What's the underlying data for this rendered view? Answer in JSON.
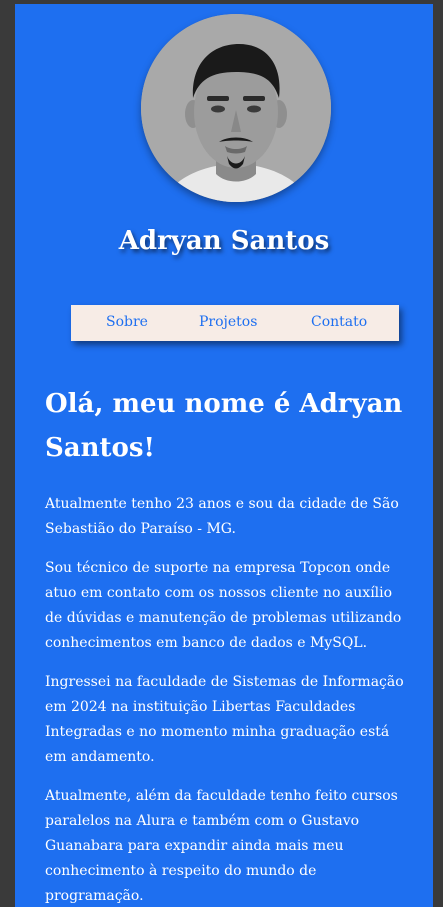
{
  "profile": {
    "name": "Adryan Santos"
  },
  "nav": {
    "items": [
      "Sobre",
      "Projetos",
      "Contato"
    ]
  },
  "main": {
    "heading": "Olá, meu nome é Adryan Santos!",
    "paragraphs": [
      "Atualmente tenho 23 anos e sou da cidade de São Sebastião do Paraíso - MG.",
      "Sou técnico de suporte na empresa Topcon onde atuo em contato com os nossos cliente no auxílio de dúvidas e manutenção de problemas utilizando conhecimentos em banco de dados e MySQL.",
      "Ingressei na faculdade de Sistemas de Informação em 2024 na instituição Libertas Faculdades Integradas e no momento minha graduação está em andamento.",
      "Atualmente, além da faculdade tenho feito cursos paralelos na Alura e também com o Gustavo Guanabara para expandir ainda mais meu conhecimento à respeito do mundo de programação."
    ]
  },
  "colors": {
    "page_bg": "#1e6ff0",
    "nav_bg": "#f7ece6",
    "text": "#ffffff",
    "outer_bg": "#3a3a3a"
  }
}
